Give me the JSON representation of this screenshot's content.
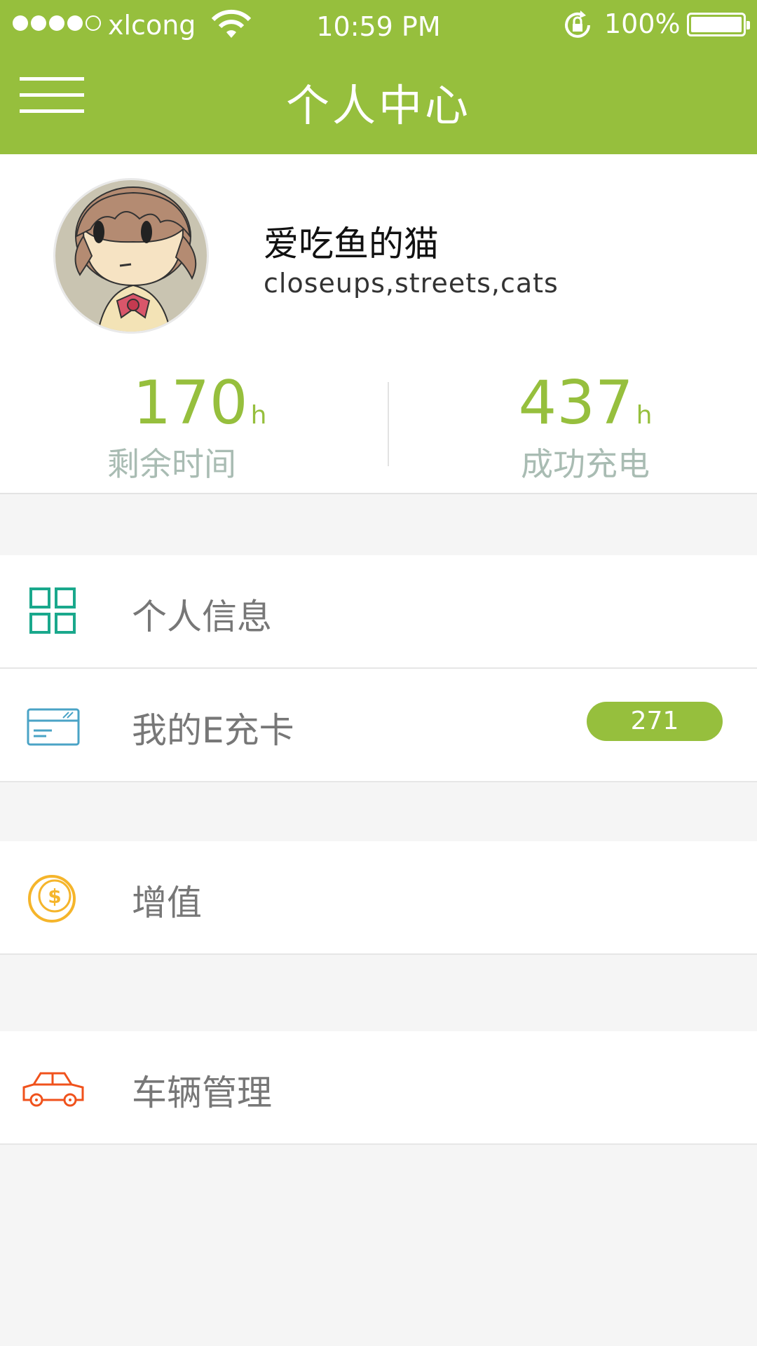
{
  "status_bar": {
    "carrier": "xlcong",
    "time": "10:59 PM",
    "battery": "100%",
    "signal_bars": 4
  },
  "header": {
    "title": "个人中心",
    "bg_color": "#96bf3d"
  },
  "profile": {
    "name": "爱吃鱼的猫",
    "tags": "closeups,streets,cats"
  },
  "stats": [
    {
      "value": "170",
      "unit": "h",
      "label": "剩余时间"
    },
    {
      "value": "437",
      "unit": "h",
      "label": "成功充电"
    }
  ],
  "menu": {
    "personal_info": "个人信息",
    "e_card": "我的E充卡",
    "e_card_badge": "271",
    "recharge": "增值",
    "vehicle": "车辆管理"
  },
  "colors": {
    "accent": "#96bf3d",
    "grid_icon": "#1aa88c",
    "card_icon": "#4aa3c6",
    "coin_icon": "#f5b52b",
    "car_icon": "#f0521c"
  }
}
